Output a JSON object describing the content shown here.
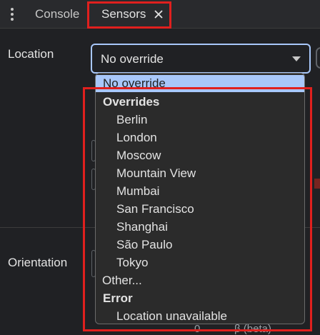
{
  "tabs": {
    "console_label": "Console",
    "sensors_label": "Sensors"
  },
  "location": {
    "label": "Location",
    "selected_value": "No override"
  },
  "orientation": {
    "label": "Orientation"
  },
  "background": {
    "beta_value": "0",
    "beta_label": "β (beta)"
  },
  "dropdown": {
    "selected_option": "No override",
    "overrides_group": "Overrides",
    "overrides": [
      "Berlin",
      "London",
      "Moscow",
      "Mountain View",
      "Mumbai",
      "San Francisco",
      "Shanghai",
      "São Paulo",
      "Tokyo"
    ],
    "other_option": "Other...",
    "error_group": "Error",
    "error_options": [
      "Location unavailable"
    ]
  },
  "colors": {
    "highlight": "#e0201e",
    "accent": "#a8c7fa",
    "background": "#202124"
  }
}
